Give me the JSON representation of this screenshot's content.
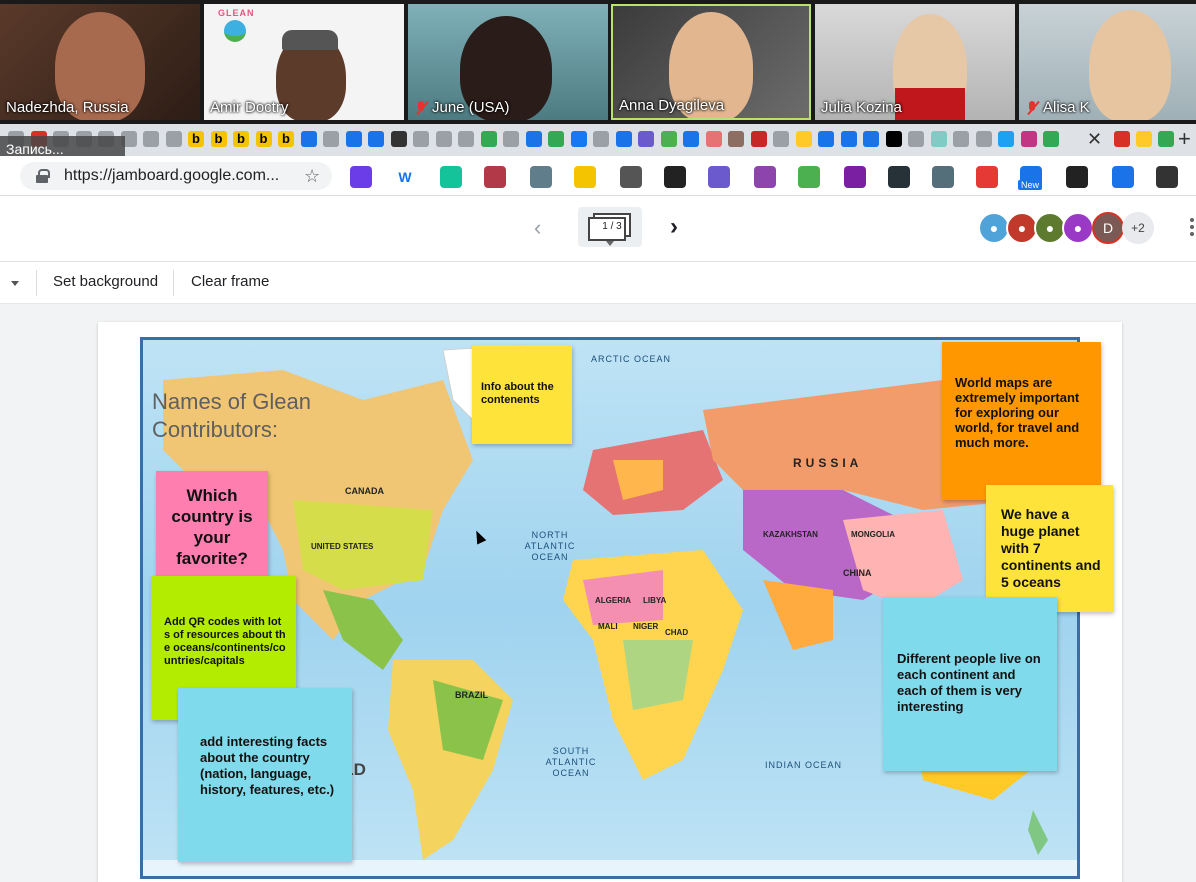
{
  "participants": [
    {
      "name": "Nadezhda, Russia",
      "muted": false
    },
    {
      "name": "Amir Doctry",
      "muted": false
    },
    {
      "name": "June (USA)",
      "muted": true
    },
    {
      "name": "Anna Dyagileva",
      "muted": false
    },
    {
      "name": "Julia Kozina",
      "muted": false
    },
    {
      "name": "Alisa K",
      "muted": true
    }
  ],
  "participant_logo_text": "GLEAN",
  "recording_chip": "Запись...",
  "browser": {
    "url": "https://jamboard.google.com...",
    "extension_badge_new": "New"
  },
  "jamboard": {
    "frame_indicator": "1 / 3",
    "more_collaborators": "+2",
    "avatar_letter": "D",
    "toolbar": {
      "set_background": "Set background",
      "clear_frame": "Clear frame"
    },
    "title_text": "Names of Glean Contributors:",
    "map_labels": {
      "arctic": "ARCTIC OCEAN",
      "north_atlantic": "NORTH ATLANTIC OCEAN",
      "south_atlantic": "SOUTH ATLANTIC OCEAN",
      "indian": "INDIAN OCEAN",
      "world_partial": "RLD"
    },
    "country_labels": {
      "canada": "CANADA",
      "usa": "UNITED STATES",
      "russia": "RUSSIA",
      "china": "CHINA",
      "brazil": "BRAZIL",
      "mongolia": "MONGOLIA",
      "kazakhstan": "KAZAKHSTAN",
      "algeria": "ALGERIA",
      "libya": "LIBYA",
      "mali": "MALI",
      "niger": "NIGER",
      "chad": "CHAD"
    },
    "notes": {
      "info_contents": "Info about the contenents",
      "world_maps": "World maps are extremely important for exploring our world, for travel and much more.",
      "favorite_country": "Which country is your favorite?",
      "huge_planet": "We have a huge planet with 7 continents and 5 oceans",
      "qr_codes": "Add QR codes with lots of resources about the oceans/continents/countries/capitals",
      "different_people": "Different people live on each continent and each of them is very interesting",
      "interesting_facts": "add interesting facts about the country (nation, language, history, features, etc.)"
    }
  },
  "colors": {
    "note_yellow": "#fde33a",
    "note_orange": "#ff9800",
    "note_pink": "#ff7eb0",
    "note_green": "#b4ec00",
    "note_blue": "#7fdbec",
    "ocean": "#a8d8f0"
  }
}
